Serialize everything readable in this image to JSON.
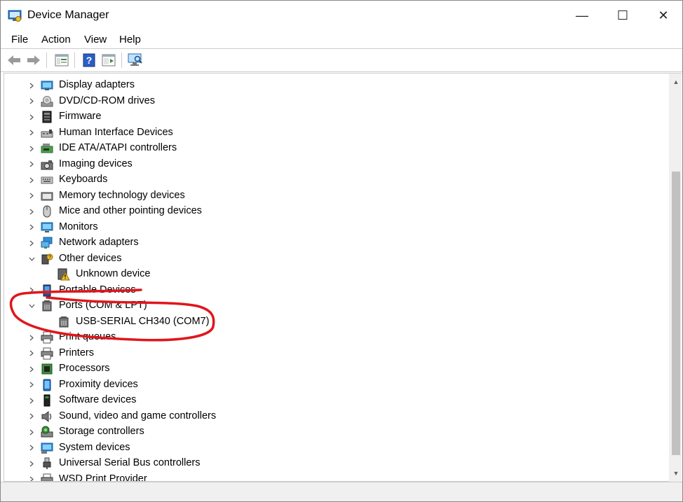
{
  "window": {
    "title": "Device Manager"
  },
  "window_controls": {
    "minimize": "—",
    "maximize": "☐",
    "close": "✕"
  },
  "menu": [
    "File",
    "Action",
    "View",
    "Help"
  ],
  "toolbar": {
    "buttons": [
      "back-arrow-icon",
      "forward-arrow-icon",
      "properties-icon",
      "help-icon",
      "update-driver-icon",
      "scan-hardware-icon"
    ]
  },
  "tree": {
    "items": [
      {
        "label": "Display adapters",
        "expanded": false,
        "level": 0,
        "icon": "display-adapter-icon"
      },
      {
        "label": "DVD/CD-ROM drives",
        "expanded": false,
        "level": 0,
        "icon": "dvd-drive-icon"
      },
      {
        "label": "Firmware",
        "expanded": false,
        "level": 0,
        "icon": "firmware-icon"
      },
      {
        "label": "Human Interface Devices",
        "expanded": false,
        "level": 0,
        "icon": "hid-icon"
      },
      {
        "label": "IDE ATA/ATAPI controllers",
        "expanded": false,
        "level": 0,
        "icon": "ide-controller-icon"
      },
      {
        "label": "Imaging devices",
        "expanded": false,
        "level": 0,
        "icon": "camera-icon"
      },
      {
        "label": "Keyboards",
        "expanded": false,
        "level": 0,
        "icon": "keyboard-icon"
      },
      {
        "label": "Memory technology devices",
        "expanded": false,
        "level": 0,
        "icon": "memory-icon"
      },
      {
        "label": "Mice and other pointing devices",
        "expanded": false,
        "level": 0,
        "icon": "mouse-icon"
      },
      {
        "label": "Monitors",
        "expanded": false,
        "level": 0,
        "icon": "monitor-icon"
      },
      {
        "label": "Network adapters",
        "expanded": false,
        "level": 0,
        "icon": "network-adapter-icon"
      },
      {
        "label": "Other devices",
        "expanded": true,
        "level": 0,
        "icon": "other-devices-icon"
      },
      {
        "label": "Unknown device",
        "expanded": null,
        "level": 1,
        "icon": "unknown-device-warning-icon"
      },
      {
        "label": "Portable Devices",
        "expanded": false,
        "level": 0,
        "icon": "portable-device-icon"
      },
      {
        "label": "Ports (COM & LPT)",
        "expanded": true,
        "level": 0,
        "icon": "port-icon"
      },
      {
        "label": "USB-SERIAL CH340 (COM7)",
        "expanded": null,
        "level": 1,
        "icon": "port-icon"
      },
      {
        "label": "Print queues",
        "expanded": false,
        "level": 0,
        "icon": "printer-icon"
      },
      {
        "label": "Printers",
        "expanded": false,
        "level": 0,
        "icon": "printer-icon"
      },
      {
        "label": "Processors",
        "expanded": false,
        "level": 0,
        "icon": "processor-icon"
      },
      {
        "label": "Proximity devices",
        "expanded": false,
        "level": 0,
        "icon": "proximity-icon"
      },
      {
        "label": "Software devices",
        "expanded": false,
        "level": 0,
        "icon": "software-device-icon"
      },
      {
        "label": "Sound, video and game controllers",
        "expanded": false,
        "level": 0,
        "icon": "sound-icon"
      },
      {
        "label": "Storage controllers",
        "expanded": false,
        "level": 0,
        "icon": "storage-controller-icon"
      },
      {
        "label": "System devices",
        "expanded": false,
        "level": 0,
        "icon": "system-devices-icon"
      },
      {
        "label": "Universal Serial Bus controllers",
        "expanded": false,
        "level": 0,
        "icon": "usb-icon"
      },
      {
        "label": "WSD Print Provider",
        "expanded": false,
        "level": 0,
        "icon": "printer-icon"
      }
    ]
  },
  "colors": {
    "annotation": "#e0161c",
    "accent": "#1f6fc5"
  }
}
